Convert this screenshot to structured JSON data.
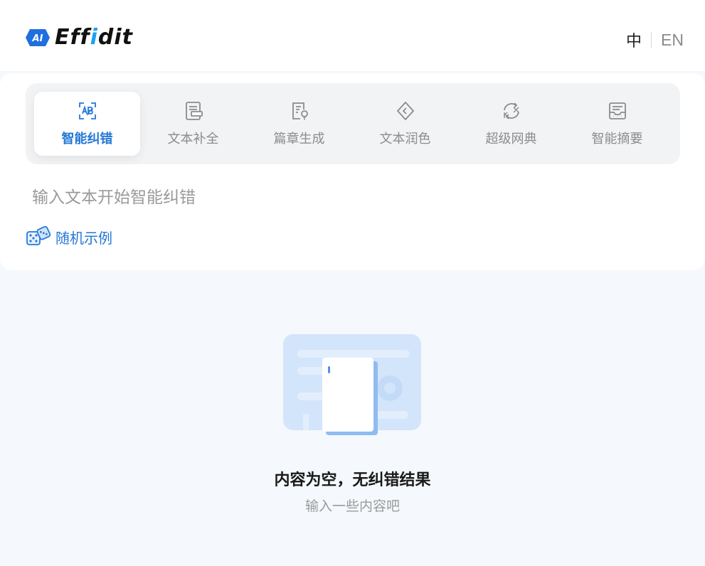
{
  "header": {
    "logo_prefix": "AI",
    "logo_text_left": "Eff",
    "logo_text_accent": "i",
    "logo_text_right": "dit",
    "lang_zh": "中",
    "lang_en": "EN"
  },
  "tabs": [
    {
      "label": "智能纠错",
      "icon": "ab-scan-icon",
      "active": true
    },
    {
      "label": "文本补全",
      "icon": "document-icon",
      "active": false
    },
    {
      "label": "篇章生成",
      "icon": "article-bulb-icon",
      "active": false
    },
    {
      "label": "文本润色",
      "icon": "tag-icon",
      "active": false
    },
    {
      "label": "超级网典",
      "icon": "swap-icon",
      "active": false
    },
    {
      "label": "智能摘要",
      "icon": "summary-icon",
      "active": false
    }
  ],
  "editor": {
    "placeholder": "输入文本开始智能纠错",
    "random_example": "随机示例"
  },
  "empty_state": {
    "title": "内容为空，无纠错结果",
    "subtitle": "输入一些内容吧"
  },
  "colors": {
    "accent": "#2478d6",
    "logo_accent": "#1da0f2",
    "illustration_light": "#cfe2fb",
    "illustration_mid": "#9cc4f2"
  }
}
